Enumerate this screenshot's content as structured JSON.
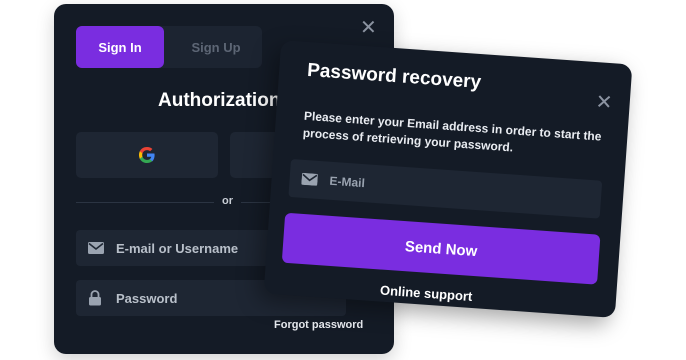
{
  "auth": {
    "tabs": [
      {
        "label": "Sign In",
        "active": true
      },
      {
        "label": "Sign Up",
        "active": false
      }
    ],
    "title": "Authorization",
    "or_label": "or",
    "email_placeholder": "E-mail or Username",
    "password_placeholder": "Password",
    "forgot_link": "Forgot password",
    "social": [
      "google-icon"
    ]
  },
  "recovery": {
    "title": "Password recovery",
    "description": "Please enter your Email address in order to start the process of retrieving your password.",
    "email_placeholder": "E-Mail",
    "send_label": "Send Now",
    "support_link": "Online support"
  },
  "colors": {
    "card_bg": "#141b26",
    "field_bg": "#1e2633",
    "accent": "#7a2de0"
  }
}
